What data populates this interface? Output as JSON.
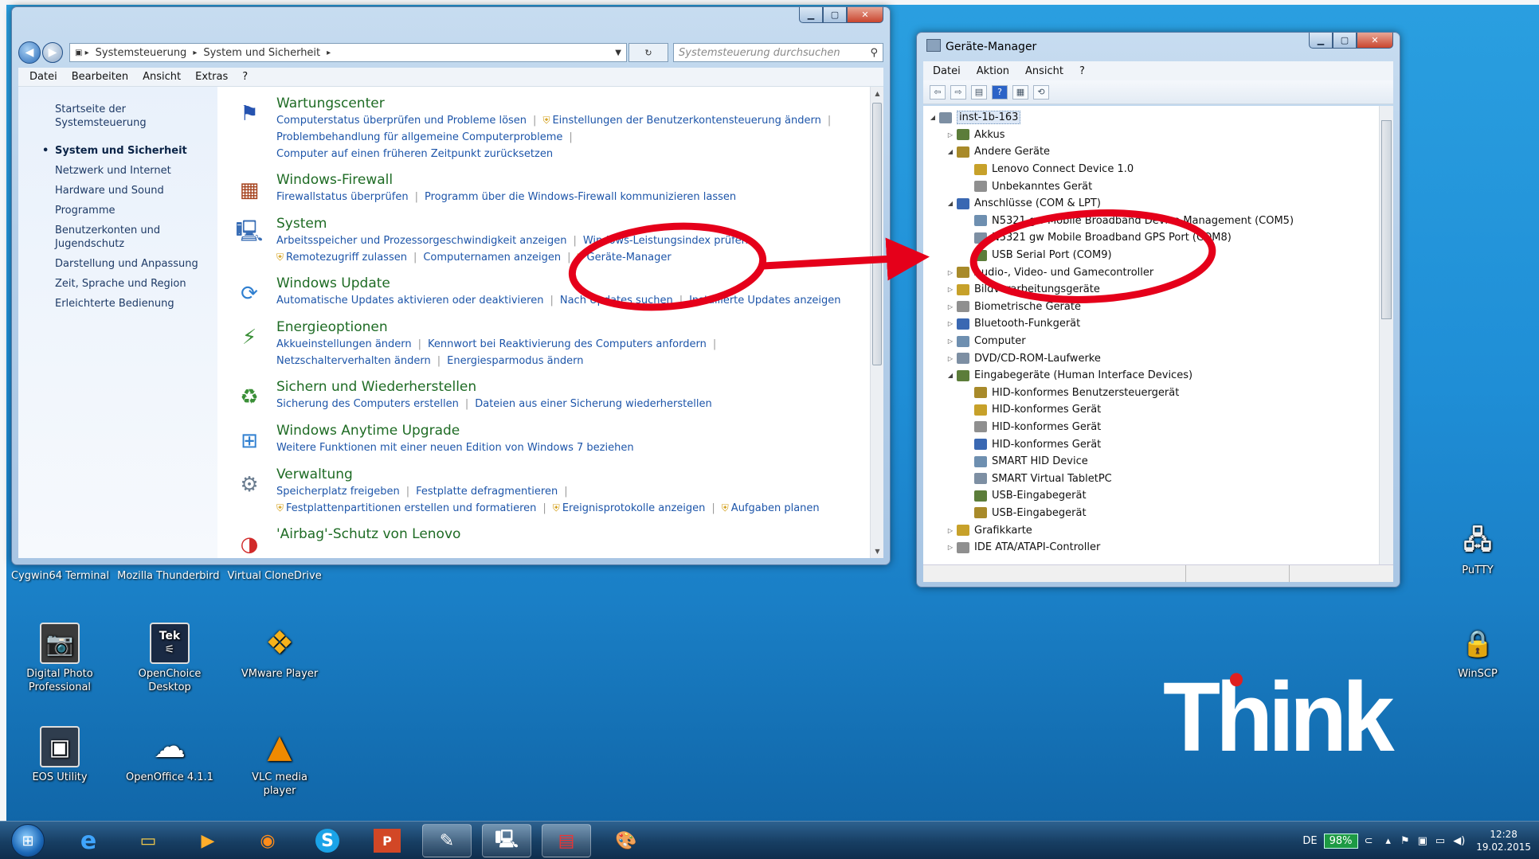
{
  "control_panel": {
    "breadcrumb": [
      "Systemsteuerung",
      "System und Sicherheit"
    ],
    "search_placeholder": "Systemsteuerung durchsuchen",
    "menu": [
      "Datei",
      "Bearbeiten",
      "Ansicht",
      "Extras",
      "?"
    ],
    "sidebar": [
      "Startseite der Systemsteuerung",
      "System und Sicherheit",
      "Netzwerk und Internet",
      "Hardware und Sound",
      "Programme",
      "Benutzerkonten und Jugendschutz",
      "Darstellung und Anpassung",
      "Zeit, Sprache und Region",
      "Erleichterte Bedienung"
    ],
    "categories": [
      {
        "title": "Wartungscenter",
        "lines": [
          [
            "Computerstatus überprüfen und Probleme lösen",
            "Einstellungen der Benutzerkontensteuerung ändern"
          ],
          [
            "Problembehandlung für allgemeine Computerprobleme"
          ],
          [
            "Computer auf einen früheren Zeitpunkt zurücksetzen"
          ]
        ]
      },
      {
        "title": "Windows-Firewall",
        "lines": [
          [
            "Firewallstatus überprüfen",
            "Programm über die Windows-Firewall kommunizieren lassen"
          ]
        ]
      },
      {
        "title": "System",
        "lines": [
          [
            "Arbeitsspeicher und Prozessorgeschwindigkeit anzeigen",
            "Windows-Leistungsindex prüfen"
          ],
          [
            "Remotezugriff zulassen",
            "Computernamen anzeigen",
            "Geräte-Manager"
          ]
        ]
      },
      {
        "title": "Windows Update",
        "lines": [
          [
            "Automatische Updates aktivieren oder deaktivieren",
            "Nach Updates suchen",
            "Installierte Updates anzeigen"
          ]
        ]
      },
      {
        "title": "Energieoptionen",
        "lines": [
          [
            "Akkueinstellungen ändern",
            "Kennwort bei Reaktivierung des Computers anfordern"
          ],
          [
            "Netzschalterverhalten ändern",
            "Energiesparmodus ändern"
          ]
        ]
      },
      {
        "title": "Sichern und Wiederherstellen",
        "lines": [
          [
            "Sicherung des Computers erstellen",
            "Dateien aus einer Sicherung wiederherstellen"
          ]
        ]
      },
      {
        "title": "Windows Anytime Upgrade",
        "lines": [
          [
            "Weitere Funktionen mit einer neuen Edition von Windows 7 beziehen"
          ]
        ]
      },
      {
        "title": "Verwaltung",
        "lines": [
          [
            "Speicherplatz freigeben",
            "Festplatte defragmentieren"
          ],
          [
            "Festplattenpartitionen erstellen und formatieren",
            "Ereignisprotokolle anzeigen",
            "Aufgaben planen"
          ]
        ]
      },
      {
        "title": "'Airbag'-Schutz von Lenovo",
        "lines": []
      }
    ]
  },
  "device_manager": {
    "title": "Geräte-Manager",
    "menu": [
      "Datei",
      "Aktion",
      "Ansicht",
      "?"
    ],
    "tree": [
      {
        "label": "inst-1b-163",
        "level": 0,
        "exp": "open",
        "sel": true
      },
      {
        "label": "Akkus",
        "level": 1,
        "exp": "closed"
      },
      {
        "label": "Andere Geräte",
        "level": 1,
        "exp": "open"
      },
      {
        "label": "Lenovo Connect Device 1.0",
        "level": 2,
        "exp": "none"
      },
      {
        "label": "Unbekanntes Gerät",
        "level": 2,
        "exp": "none"
      },
      {
        "label": "Anschlüsse (COM & LPT)",
        "level": 1,
        "exp": "open"
      },
      {
        "label": "N5321 gw Mobile Broadband Device Management (COM5)",
        "level": 2,
        "exp": "none"
      },
      {
        "label": "N5321 gw Mobile Broadband GPS Port (COM8)",
        "level": 2,
        "exp": "none"
      },
      {
        "label": "USB Serial Port (COM9)",
        "level": 2,
        "exp": "none"
      },
      {
        "label": "Audio-, Video- und Gamecontroller",
        "level": 1,
        "exp": "closed"
      },
      {
        "label": "Bildverarbeitungsgeräte",
        "level": 1,
        "exp": "closed"
      },
      {
        "label": "Biometrische Geräte",
        "level": 1,
        "exp": "closed"
      },
      {
        "label": "Bluetooth-Funkgerät",
        "level": 1,
        "exp": "closed"
      },
      {
        "label": "Computer",
        "level": 1,
        "exp": "closed"
      },
      {
        "label": "DVD/CD-ROM-Laufwerke",
        "level": 1,
        "exp": "closed"
      },
      {
        "label": "Eingabegeräte (Human Interface Devices)",
        "level": 1,
        "exp": "open"
      },
      {
        "label": "HID-konformes Benutzersteuergerät",
        "level": 2,
        "exp": "none"
      },
      {
        "label": "HID-konformes Gerät",
        "level": 2,
        "exp": "none"
      },
      {
        "label": "HID-konformes Gerät",
        "level": 2,
        "exp": "none"
      },
      {
        "label": "HID-konformes Gerät",
        "level": 2,
        "exp": "none"
      },
      {
        "label": "SMART HID Device",
        "level": 2,
        "exp": "none"
      },
      {
        "label": "SMART Virtual TabletPC",
        "level": 2,
        "exp": "none"
      },
      {
        "label": "USB-Eingabegerät",
        "level": 2,
        "exp": "none"
      },
      {
        "label": "USB-Eingabegerät",
        "level": 2,
        "exp": "none"
      },
      {
        "label": "Grafikkarte",
        "level": 1,
        "exp": "closed"
      },
      {
        "label": "IDE ATA/ATAPI-Controller",
        "level": 1,
        "exp": "closed"
      }
    ]
  },
  "desktop": {
    "top_row_labels": [
      "Cygwin64 Terminal",
      "Mozilla Thunderbird",
      "Virtual CloneDrive"
    ],
    "icons": [
      {
        "label": "Digital Photo Professional",
        "icon": "camera-photo-icon"
      },
      {
        "label": "OpenChoice Desktop",
        "icon": "tek-icon"
      },
      {
        "label": "VMware Player",
        "icon": "vmware-icon"
      },
      {
        "label": "EOS Utility",
        "icon": "eos-camera-icon"
      },
      {
        "label": "OpenOffice 4.1.1",
        "icon": "openoffice-icon"
      },
      {
        "label": "VLC media player",
        "icon": "vlc-cone-icon"
      },
      {
        "label": "PuTTY",
        "icon": "putty-icon"
      },
      {
        "label": "WinSCP",
        "icon": "winscp-icon"
      }
    ],
    "tek_badge": "Tek",
    "brand": "Think"
  },
  "taskbar": {
    "lang": "DE",
    "battery": "98%",
    "time": "12:28",
    "date": "19.02.2015",
    "items": [
      "ie-icon",
      "explorer-icon",
      "media-icon",
      "firefox-icon",
      "skype-icon",
      "powerpoint-icon",
      "paint-icon",
      "device-manager-icon",
      "toolbox-icon",
      "paint-palette-icon"
    ]
  }
}
